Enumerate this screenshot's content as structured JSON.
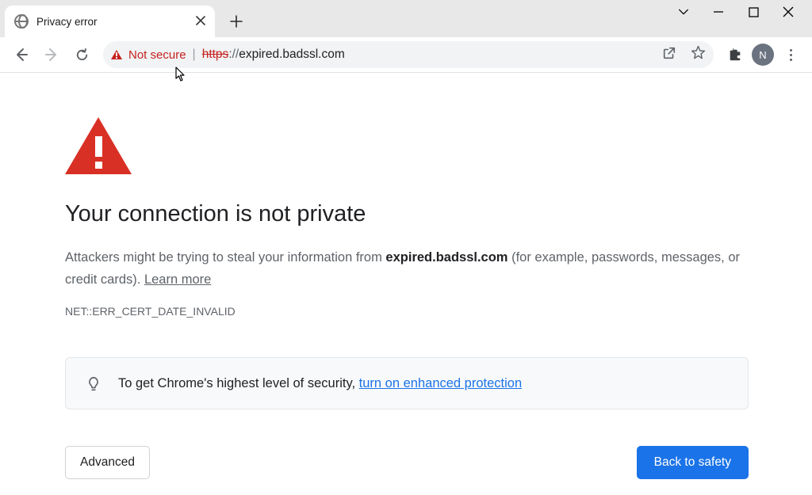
{
  "tab": {
    "title": "Privacy error"
  },
  "omnibox": {
    "not_secure": "Not secure",
    "url_scheme": "https",
    "url_sep": "://",
    "url_rest": "expired.badssl.com"
  },
  "avatar_letter": "N",
  "interstitial": {
    "heading": "Your connection is not private",
    "body_prefix": "Attackers might be trying to steal your information from ",
    "body_host": "expired.badssl.com",
    "body_suffix": " (for example, passwords, messages, or credit cards). ",
    "learn_more": "Learn more",
    "error_code": "NET::ERR_CERT_DATE_INVALID",
    "promo_prefix": "To get Chrome's highest level of security, ",
    "promo_link": "turn on enhanced protection",
    "advanced_label": "Advanced",
    "back_label": "Back to safety"
  }
}
